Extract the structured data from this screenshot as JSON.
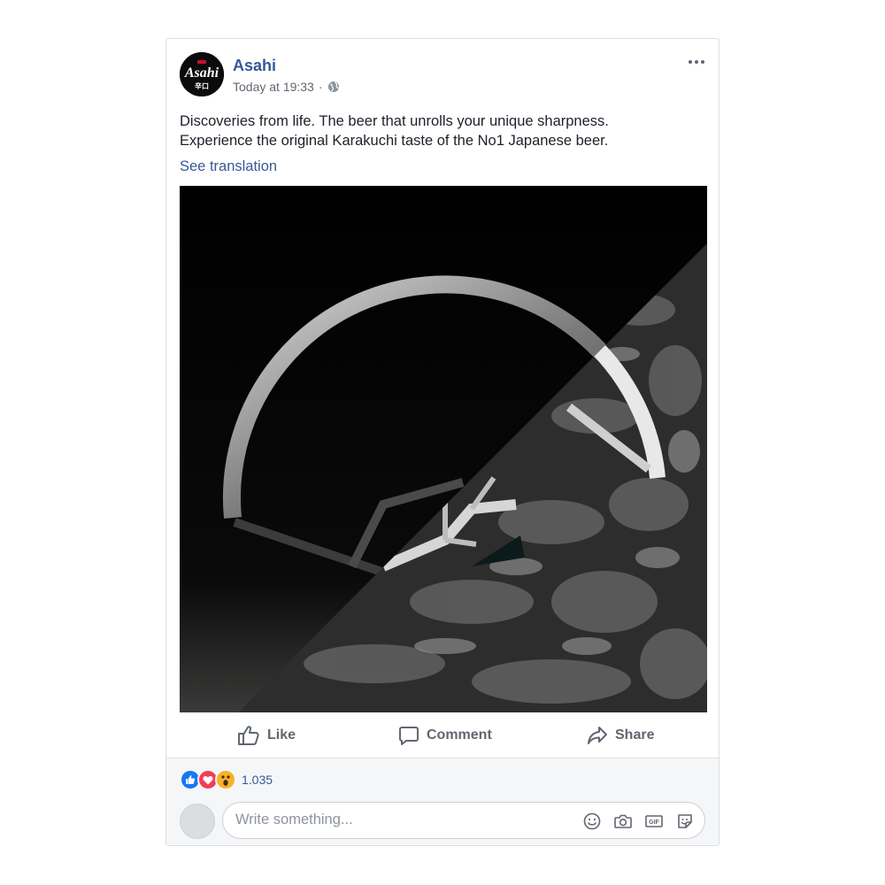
{
  "post": {
    "page_name": "Asahi",
    "timestamp": "Today at 19:33",
    "separator": "·",
    "privacy_icon": "globe-icon",
    "caption_lines": [
      "Discoveries from life. The beer that unrolls your unique sharpness.",
      "Experience the original Karakuchi taste of the No1 Japanese beer."
    ],
    "see_translation": "See translation",
    "avatar_logo": {
      "text": "Asahi",
      "sub": "辛口",
      "colors": {
        "background": "#0b0b0b",
        "text": "#ffffff",
        "accent": "#c8102e"
      }
    }
  },
  "actions": {
    "like_label": "Like",
    "comment_label": "Comment",
    "share_label": "Share"
  },
  "reactions": {
    "icons": [
      "like-reaction-icon",
      "love-reaction-icon",
      "wow-reaction-icon"
    ],
    "count": "1.035"
  },
  "comment_composer": {
    "placeholder": "Write something...",
    "icons": [
      "emoji-icon",
      "camera-icon",
      "gif-icon",
      "sticker-icon"
    ]
  },
  "colors": {
    "link": "#385898",
    "secondary_text": "#616770",
    "action_text": "#606770",
    "footer_bg": "#f5f6f7",
    "like_blue": "#1877f2",
    "love_red": "#f33e58",
    "wow_yellow": "#f7b125"
  }
}
